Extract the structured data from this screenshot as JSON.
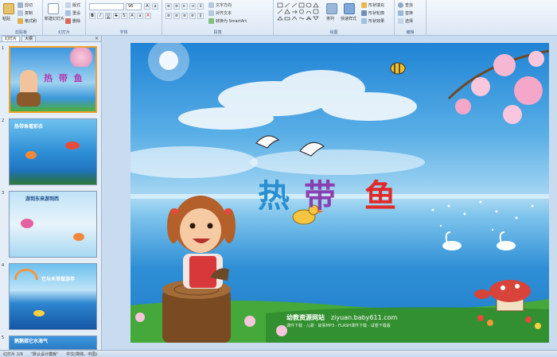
{
  "ribbon": {
    "groups": [
      {
        "label": "剪贴板",
        "buttons": [
          "粘贴",
          "剪切",
          "复制",
          "格式刷"
        ]
      },
      {
        "label": "幻灯片",
        "buttons": [
          "新建幻灯片",
          "版式",
          "重设",
          "删除"
        ]
      },
      {
        "label": "字体",
        "font_size": "96"
      },
      {
        "label": "段落",
        "buttons": [
          "文字方向",
          "对齐文本",
          "转换为 SmartArt"
        ]
      },
      {
        "label": "绘图",
        "buttons": [
          "排列",
          "快速样式",
          "形状填充",
          "形状轮廓",
          "形状效果"
        ]
      },
      {
        "label": "编辑",
        "buttons": [
          "查找",
          "替换",
          "选择"
        ]
      }
    ]
  },
  "pane": {
    "tabs": [
      "幻灯片",
      "大纲"
    ],
    "close": "×",
    "slides": [
      {
        "num": "1",
        "title": "热 带 鱼"
      },
      {
        "num": "2",
        "title": "热带鱼看彩衣"
      },
      {
        "num": "3",
        "title": "游到东来游到西"
      },
      {
        "num": "4",
        "title": "它与禾草做游伴"
      },
      {
        "num": "5",
        "title": "鹅鹅摇它水海气"
      }
    ]
  },
  "slide": {
    "title_chars": [
      "热",
      "带",
      "鱼"
    ],
    "title_colors": [
      "#2a8fd0",
      "#8a3fb0",
      "#e02a2a"
    ],
    "footer_brand": "幼教资源网站",
    "footer_url": "ziyuan.baby611.com",
    "footer_sub": "课件下载 · 儿歌 · 故事MP3 · FLASH课件下载 · 试卷下载版"
  },
  "status": {
    "slide_info": "幻灯片 1/9",
    "theme": "\"默认设计模板\"",
    "lang": "中文(简体，中国)"
  }
}
